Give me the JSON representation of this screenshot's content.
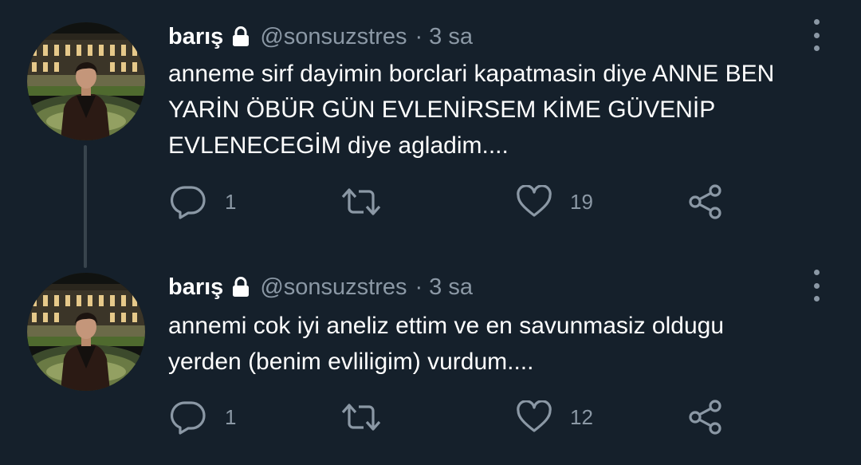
{
  "colors": {
    "background": "#15202b",
    "text_primary": "#ffffff",
    "text_secondary": "#8b98a5",
    "thread_line": "#38444d"
  },
  "tweets": [
    {
      "display_name": "barış",
      "handle": "@sonsuzstres",
      "separator": "·",
      "time": "3 sa",
      "text": "anneme sirf dayimin borclari kapatmasin diye ANNE BEN\nYARİN ÖBÜR GÜN EVLENİRSEM KİME GÜVENİP\nEVLENECEGİM diye agladim....",
      "reply_count": "1",
      "retweet_count": "",
      "like_count": "19",
      "icons": {
        "lock": "lock-icon",
        "reply": "reply-icon",
        "retweet": "retweet-icon",
        "like": "heart-icon",
        "share": "share-icon",
        "more": "more-vertical-icon"
      }
    },
    {
      "display_name": "barış",
      "handle": "@sonsuzstres",
      "separator": "·",
      "time": "3 sa",
      "text": "annemi cok iyi aneliz ettim ve en savunmasiz oldugu\nyerden (benim evliligim) vurdum....",
      "reply_count": "1",
      "retweet_count": "",
      "like_count": "12",
      "icons": {
        "lock": "lock-icon",
        "reply": "reply-icon",
        "retweet": "retweet-icon",
        "like": "heart-icon",
        "share": "share-icon",
        "more": "more-vertical-icon"
      }
    }
  ]
}
